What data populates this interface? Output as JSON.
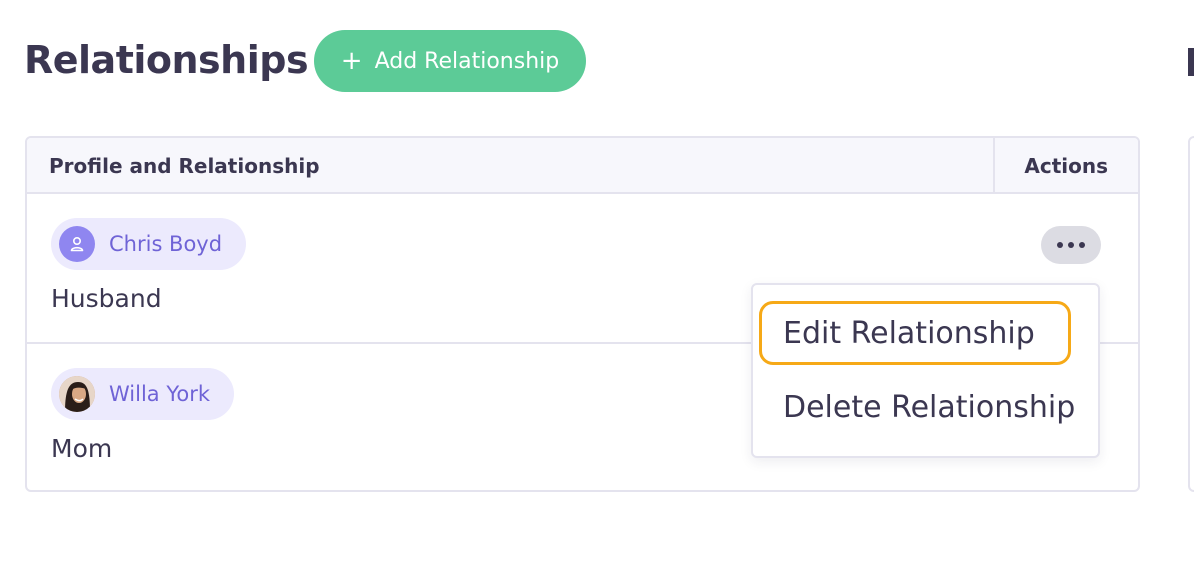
{
  "header": {
    "title": "Relationships",
    "add_button_label": "Add Relationship",
    "add_button_icon": "plus-icon"
  },
  "table": {
    "columns": [
      "Profile and Relationship",
      "Actions"
    ],
    "rows": [
      {
        "name": "Chris Boyd",
        "relation": "Husband",
        "avatar": "person-icon"
      },
      {
        "name": "Willa York",
        "relation": "Mom",
        "avatar": "photo"
      }
    ]
  },
  "actions_menu": {
    "items": [
      "Edit Relationship",
      "Delete Relationship"
    ],
    "highlighted_item": "Edit Relationship"
  },
  "colors": {
    "accent_green": "#5ccb97",
    "chip_bg": "#eceafd",
    "chip_text": "#6f63d6",
    "focus_ring": "#f6a917"
  }
}
